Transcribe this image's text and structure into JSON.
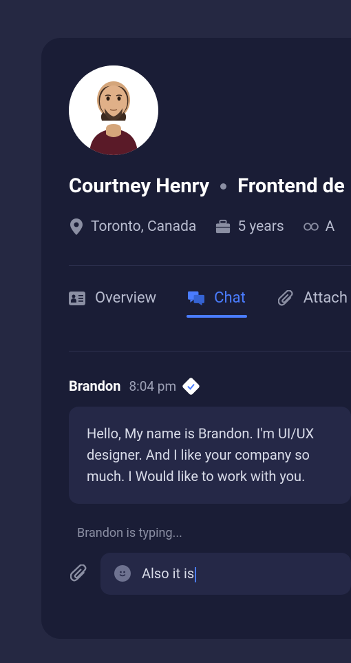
{
  "profile": {
    "name": "Courtney Henry",
    "role": "Frontend de",
    "location": "Toronto, Canada",
    "experience": "5 years",
    "extra": "A"
  },
  "tabs": {
    "overview": "Overview",
    "chat": "Chat",
    "attachments": "Attach"
  },
  "chat": {
    "sender": "Brandon",
    "time": "8:04 pm",
    "message": "Hello, My name is Brandon. I'm UI/UX designer. And I like your company so much. I Would like to work with you.",
    "typing": "Brandon is typing...",
    "input": "Also it is"
  }
}
